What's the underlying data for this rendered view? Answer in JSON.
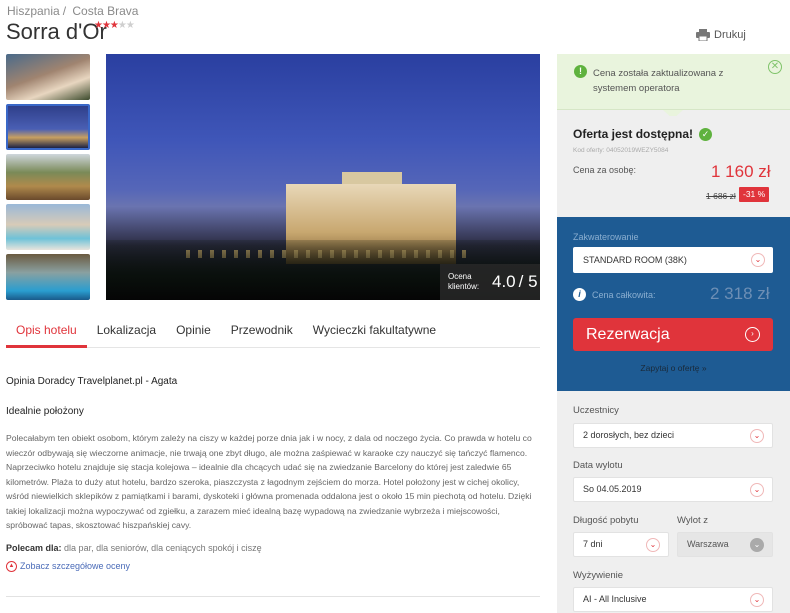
{
  "breadcrumb": {
    "country": "Hiszpania",
    "separator": "/",
    "region": "Costa Brava"
  },
  "hotel": {
    "name": "Sorra d'Or",
    "stars_filled": 3,
    "stars_total": 5,
    "stars_on": "★★★",
    "stars_off": "★★"
  },
  "print": {
    "icon": "printer-icon",
    "label": "Drukuj"
  },
  "gallery": {
    "thumbnail_count": 5
  },
  "rating": {
    "label": "Ocena klientów:",
    "value": "4.0",
    "max": "/ 5"
  },
  "tabs": [
    {
      "label": "Opis hotelu",
      "active": true
    },
    {
      "label": "Lokalizacja",
      "active": false
    },
    {
      "label": "Opinie",
      "active": false
    },
    {
      "label": "Przewodnik",
      "active": false
    },
    {
      "label": "Wycieczki fakultatywne",
      "active": false
    }
  ],
  "opinion": {
    "title": "Opinia Doradcy Travelplanet.pl - Agata",
    "heading": "Idealnie położony",
    "body": "Polecałabym ten obiekt osobom, którym zależy na ciszy w każdej porze dnia jak i w nocy, z dala od noczego życia. Co prawda w hotelu co wieczór odbywają się wieczorne animacje, nie trwają one zbyt długo, ale można zaśpiewać w karaoke czy nauczyć się tańczyć flamenco. Naprzeciwko hotelu znajduje się stacja kolejowa – idealnie dla chcących udać się na zwiedzanie Barcelony do której jest zaledwie 65 kilometrów. Plaża to duży atut hotelu, bardzo szeroka, piaszczysta z łagodnym zejściem do morza. Hotel położony jest w cichej okolicy, wśród niewielkich sklepików z pamiątkami i barami, dyskoteki i główna promenada oddalona jest o około 15 min piechotą od hotelu. Dzięki takiej lokalizacji można wypoczywać od zgiełku, a zarazem mieć idealną bazę wypadową na zwiedzanie wybrzeża i miejscowości, spróbować tapas, skosztować hiszpańskiej cavy.",
    "recommend_label": "Polecam dla:",
    "recommend_value": "dla par, dla seniorów, dla ceniących spokój i ciszę",
    "details_link": "Zobacz szczegółowe oceny"
  },
  "notice": {
    "message": "Cena została zaktualizowana z systemem operatora",
    "close": "✕"
  },
  "offer": {
    "title": "Oferta jest dostępna!",
    "code": "Kod oferty: 04052019WEZY5084",
    "price_label": "Cena za osobę:",
    "price_new": "1 160 zł",
    "price_old": "1 686 zł",
    "discount": "-31 %"
  },
  "booking": {
    "room_label": "Zakwaterowanie",
    "room_value": "STANDARD ROOM (38K)",
    "total_label": "Cena całkowita:",
    "total_value": "2 318 zł",
    "reserve_label": "Rezerwacja",
    "ask_label": "Zapytaj o ofertę »"
  },
  "filters": {
    "participants_label": "Uczestnicy",
    "participants_value": "2 dorosłych, bez dzieci",
    "departure_date_label": "Data wylotu",
    "departure_date_value": "So 04.05.2019",
    "duration_label": "Długość pobytu",
    "duration_value": "7 dni",
    "from_label": "Wylot z",
    "from_value": "Warszawa",
    "board_label": "Wyżywienie",
    "board_value": "AI - All Inclusive"
  },
  "colors": {
    "accent": "#e0343b",
    "booking_bg": "#1e5b93",
    "success": "#5fb23e",
    "notice_bg": "#e9f4dd"
  }
}
